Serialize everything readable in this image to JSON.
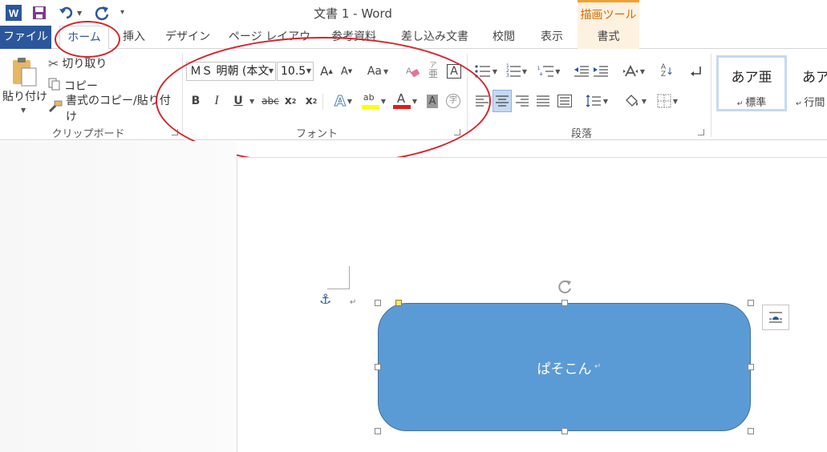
{
  "title": "文書 1 - Word",
  "draw_tools_label": "描画ツール",
  "tabs": {
    "file": "ファイル",
    "home": "ホーム",
    "insert": "挿入",
    "design": "デザイン",
    "layout": "ページ レイアウト",
    "references": "参考資料",
    "mailings": "差し込み文書",
    "review": "校閲",
    "view": "表示",
    "format": "書式"
  },
  "clipboard": {
    "paste": "貼り付け",
    "cut": "切り取り",
    "copy": "コピー",
    "format_painter": "書式のコピー/貼り付け",
    "label": "クリップボード"
  },
  "font": {
    "name": "ＭＳ 明朝 (本文",
    "size": "10.5",
    "case": "Aa",
    "label": "フォント",
    "bold": "B",
    "italic": "I",
    "underline": "U",
    "strike": "abc",
    "subscript": "x",
    "superscript": "x",
    "subscript_mark": "2",
    "superscript_mark": "2",
    "grow": "A",
    "shrink": "A",
    "phonetic_small": "ア",
    "phonetic_base": "亜",
    "border_char": "A",
    "effects_char": "A",
    "highlight_char": "ab",
    "color_char": "A",
    "shade_char": "A",
    "enclose_char": "字"
  },
  "paragraph": {
    "label": "段落",
    "numbering_1": "1",
    "numbering_2": "2",
    "numbering_3": "3",
    "multilevel_1": "1",
    "multilevel_a": "a",
    "sort_a": "A",
    "sort_z": "Z"
  },
  "styles": {
    "standard_preview": "あア亜",
    "standard_label": "標準",
    "nospace_preview": "あア",
    "nospace_label": "行間"
  },
  "document": {
    "shape_text": "ぱそこん"
  },
  "colors": {
    "file_tab": "#2b579a",
    "shape_fill": "#5b9bd5",
    "annotation": "#d9222a",
    "draw_tools": "#d56a00"
  }
}
